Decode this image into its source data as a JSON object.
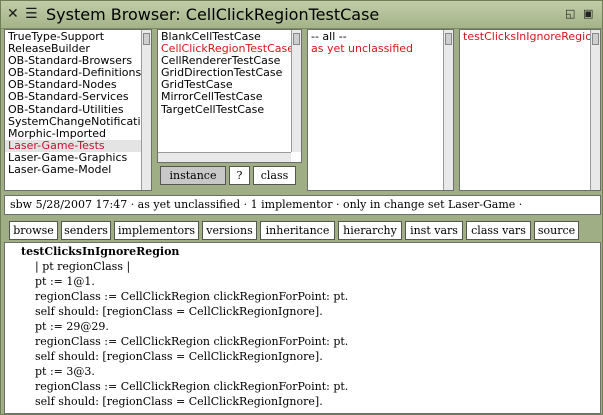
{
  "window": {
    "title": "System Browser: CellClickRegionTestCase"
  },
  "categories": [
    "TrueType-Support",
    "ReleaseBuilder",
    "OB-Standard-Browsers",
    "OB-Standard-Definitions",
    "OB-Standard-Nodes",
    "OB-Standard-Services",
    "OB-Standard-Utilities",
    "SystemChangeNotification",
    "Morphic-Imported",
    "Laser-Game-Tests",
    "Laser-Game-Graphics",
    "Laser-Game-Model"
  ],
  "classes": [
    "BlankCellTestCase",
    "CellClickRegionTestCase",
    "CellRendererTestCase",
    "GridDirectionTestCase",
    "GridTestCase",
    "MirrorCellTestCase",
    "TargetCellTestCase"
  ],
  "protocols": [
    "-- all --",
    "as yet unclassified"
  ],
  "methods": [
    "testClicksInIgnoreRegion"
  ],
  "class_buttons": {
    "instance": "instance",
    "question": "?",
    "class": "class"
  },
  "status": "sbw 5/28/2007 17:47 · as yet unclassified · 1 implementor · only in change set Laser-Game  ·",
  "toolbar": {
    "browse": "browse",
    "senders": "senders",
    "implementors": "implementors",
    "versions": "versions",
    "inheritance": "inheritance",
    "hierarchy": "hierarchy",
    "inst_vars": "inst vars",
    "class_vars": "class vars",
    "source": "source"
  },
  "code": {
    "signature": "testClicksInIgnoreRegion",
    "lines": [
      "    | pt regionClass |",
      "    pt := 1@1.",
      "    regionClass := CellClickRegion clickRegionForPoint: pt.",
      "    self should: [regionClass = CellClickRegionIgnore].",
      "    pt := 29@29.",
      "    regionClass := CellClickRegion clickRegionForPoint: pt.",
      "    self should: [regionClass = CellClickRegionIgnore].",
      "    pt := 3@3.",
      "    regionClass := CellClickRegion clickRegionForPoint: pt.",
      "    self should: [regionClass = CellClickRegionIgnore]."
    ]
  },
  "colors": {
    "window_frame": "#9fae84",
    "selection_text": "#c8102e",
    "selection_bg": "#e4e4e4"
  }
}
